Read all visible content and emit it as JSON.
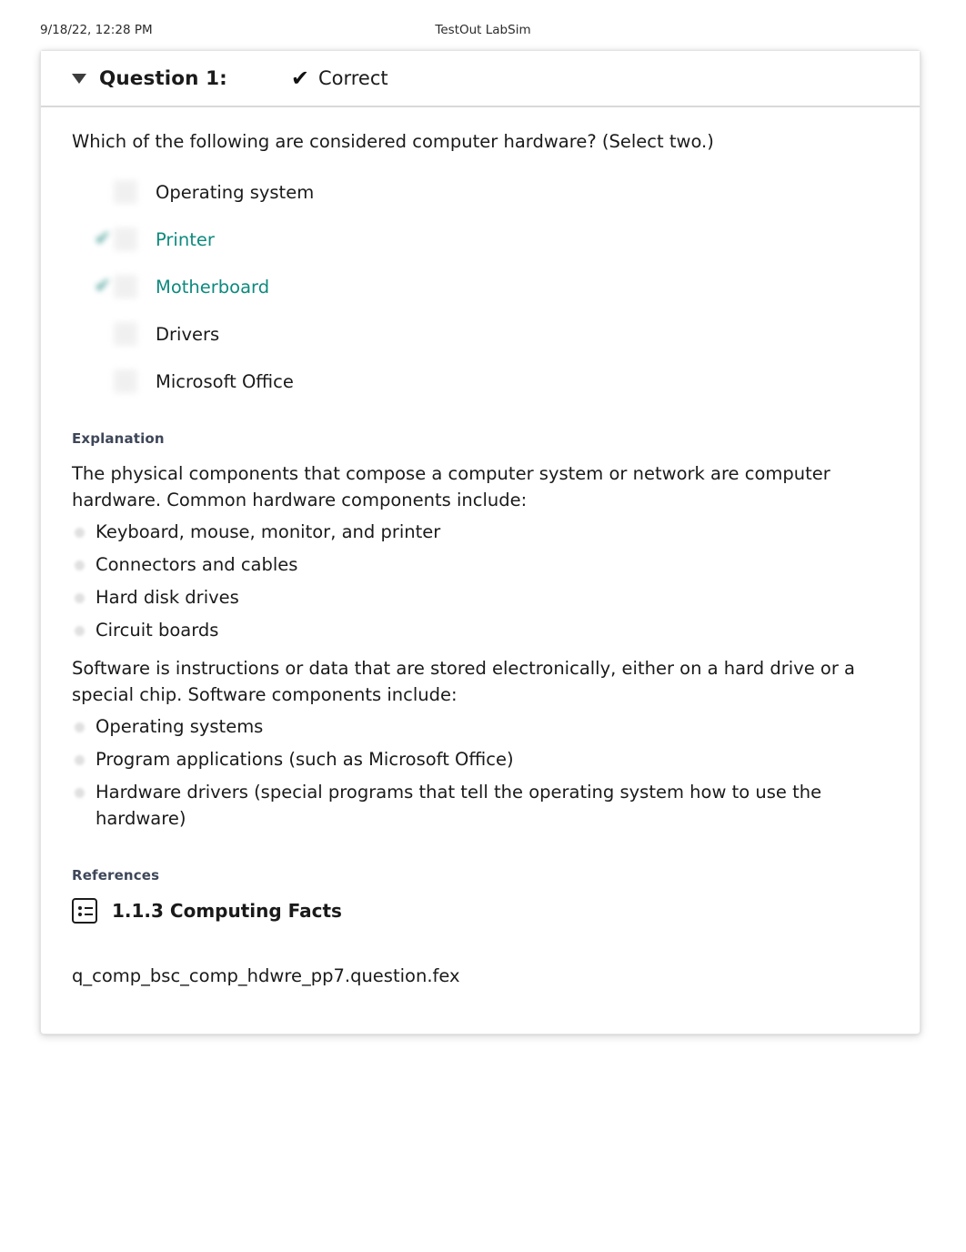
{
  "print_header": {
    "date": "9/18/22, 12:28 PM",
    "title": "TestOut LabSim"
  },
  "question_card": {
    "header": {
      "caret_icon": "triangle-down-icon",
      "question_label": "Question 1:",
      "status_icon": "checkmark-icon",
      "status_text": "Correct"
    },
    "stem": "Which of the following are considered computer hardware? (Select two.)",
    "options": [
      {
        "label": "Operating system",
        "selected": false
      },
      {
        "label": "Printer",
        "selected": true
      },
      {
        "label": "Motherboard",
        "selected": true
      },
      {
        "label": "Drivers",
        "selected": false
      },
      {
        "label": "Microsoft Office",
        "selected": false
      }
    ],
    "explanation": {
      "heading": "Explanation",
      "paragraph_1": "The physical components that compose a computer system or network are computer hardware. Common hardware components include:",
      "hardware_bullets": [
        "Keyboard, mouse, monitor, and printer",
        "Connectors and cables",
        "Hard disk drives",
        "Circuit boards"
      ],
      "paragraph_2": "Software is instructions or data that are stored electronically, either on a hard drive or a special chip. Software components include:",
      "software_bullets": [
        "Operating systems",
        "Program applications (such as Microsoft Office)",
        "Hardware drivers (special programs that tell the operating system how to use the hardware)"
      ]
    },
    "references": {
      "heading": "References",
      "icon": "list-box-icon",
      "title": "1.1.3 Computing Facts"
    },
    "file_name": "q_comp_bsc_comp_hdwre_pp7.question.fex"
  },
  "colors": {
    "selected_teal": "#0e8a7e",
    "section_heading": "#3e4759",
    "text": "#1a1a1a"
  }
}
